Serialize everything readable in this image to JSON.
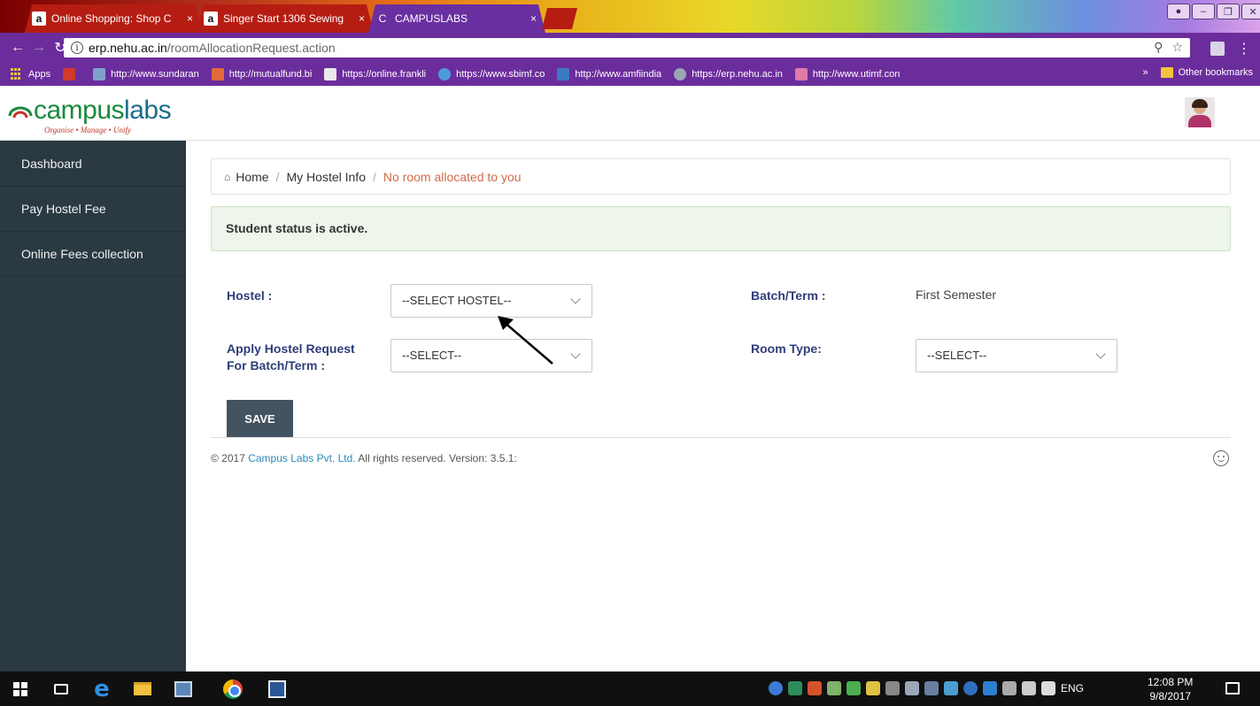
{
  "browser": {
    "tabs": [
      {
        "favicon": "a",
        "title": "Online Shopping: Shop C",
        "active": false
      },
      {
        "favicon": "a",
        "title": "Singer Start 1306 Sewing",
        "active": false
      },
      {
        "favicon": "C",
        "title": "CAMPUSLABS",
        "active": true
      }
    ],
    "close_glyph": "×",
    "url_host": "erp.nehu.ac.in",
    "url_path": "/roomAllocationRequest.action",
    "bookmarks": [
      {
        "label": "Apps"
      },
      {
        "label": ""
      },
      {
        "label": "http://www.sundaran"
      },
      {
        "label": "http://mutualfund.bi"
      },
      {
        "label": "https://online.frankli"
      },
      {
        "label": "https://www.sbimf.co"
      },
      {
        "label": "http://www.amfiindia"
      },
      {
        "label": "https://erp.nehu.ac.in"
      },
      {
        "label": "http://www.utimf.con"
      }
    ],
    "overflow": "»",
    "other_bookmarks": "Other bookmarks"
  },
  "app": {
    "brand_a": "campus",
    "brand_b": "labs",
    "tagline": "Organise • Manage • Unify"
  },
  "sidebar": {
    "items": [
      {
        "label": "Dashboard"
      },
      {
        "label": "Pay Hostel Fee"
      },
      {
        "label": "Online Fees collection"
      }
    ]
  },
  "breadcrumb": {
    "home": "Home",
    "section": "My Hostel Info",
    "current": "No room allocated to you",
    "separator": "/"
  },
  "alert": {
    "text": "Student status is active."
  },
  "form": {
    "hostel_label": "Hostel :",
    "hostel_value": "--SELECT HOSTEL--",
    "batch_term_label": "Batch/Term :",
    "batch_term_value": "First Semester",
    "apply_label_1": "Apply Hostel Request",
    "apply_label_2": "For Batch/Term :",
    "apply_value": "--SELECT--",
    "room_type_label": "Room Type:",
    "room_type_value": "--SELECT--",
    "save_label": "SAVE"
  },
  "footer": {
    "prefix": "© 2017 ",
    "company": "Campus Labs Pvt. Ltd.",
    "suffix": " All rights reserved. Version: 3.5.1:"
  },
  "taskbar": {
    "lang": "ENG",
    "time": "12:08 PM",
    "date": "9/8/2017"
  }
}
